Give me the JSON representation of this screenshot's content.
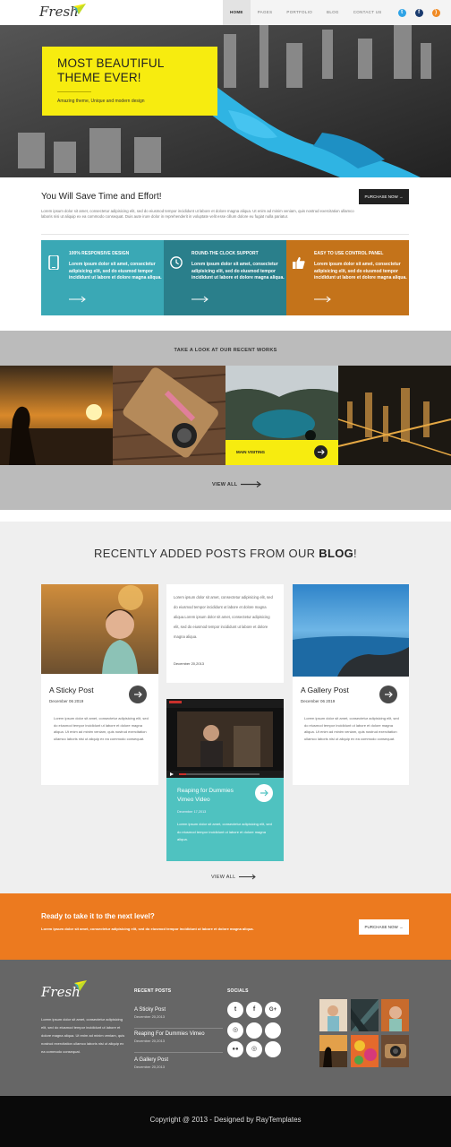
{
  "header": {
    "logo": "Fresh",
    "nav": [
      "HOME",
      "PAGES",
      "PORTFOLIO",
      "BLOG",
      "CONTACT US"
    ],
    "social_icons": [
      "twitter-icon",
      "facebook-icon",
      "rss-icon"
    ]
  },
  "hero": {
    "title": "MOST BEAUTIFUL THEME EVER!",
    "subtitle": "Amazing theme, Unique and modern design"
  },
  "intro": {
    "title": "You Will Save Time and Effort!",
    "text": "Lorem ipsum dolor sit amet, consectetur adipisicing elit, sed do eiusmod tempor incididunt ut labore et dolore magna aliqua. Ut enim ad minim veniam, quis nostrud exercitation ullamco laboris nisi ut aliquip ex ea commodo consequat. Duis aute irure dolor in reprehenderit in voluptate velit esse cillum dolore eu fugiat nulla pariatur.",
    "button": "PURCHASE NOW"
  },
  "features": [
    {
      "title": "100% RESPONSIVE DESIGN",
      "text": "Lorem ipsum dolor sit amet, consectetur adipisicing elit, sed do eiusmod tempor incididunt ut labore et dolore magna aliqua.",
      "color": "#3aa8b5"
    },
    {
      "title": "ROUND-THE CLOCK SUPPORT",
      "text": "Lorem ipsum dolor sit amet, consectetur adipisicing elit, sed do eiusmod tempor incididunt ut labore et dolore magna aliqua.",
      "color": "#2a7f8b"
    },
    {
      "title": "EASY TO USE CONTROL PANEL",
      "text": "Lorem ipsum dolor sit amet, consectetur adipisicing elit, sed do eiusmod tempor incididunt ut labore et dolore magna aliqua.",
      "color": "#c4731a"
    }
  ],
  "works": {
    "title": "TAKE A LOOK AT OUR RECENT WORKS",
    "overlay_label": "MAIN VISITING",
    "view_all": "VIEW ALL"
  },
  "blog": {
    "title_prefix": "RECENTLY ADDED POSTS FROM OUR ",
    "title_bold": "BLOG",
    "title_suffix": "!",
    "posts": [
      {
        "title": "A Sticky Post",
        "date": "December 06 2019",
        "text": "Lorem ipsum dolor sit amet, consectetur adipisicing elit, sed do eiusmod tempor incididunt ut labore et dolore magna aliqua. Ut enim ad minim veniam, quis nostrud exercitation ullamco laboris nisi ut aliquip ex ea commodo consequat."
      },
      {
        "title": "",
        "date": "December 20,2013",
        "text": "Lorem ipsum dolor sit amet, consectetur adipisicing elit, sed do eiusmod tempor incididunt ut labore et dolore magna aliqua.Lorem ipsum dolor sit amet, consectetur adipisicing elit, sed do eiusmod tempor incididunt ut labore et dolore magna aliqua."
      },
      {
        "title": "A Gallery Post",
        "date": "December 06 2019",
        "text": "Lorem ipsum dolor sit amet, consectetur adipisicing elit, sed do eiusmod tempor incididunt ut labore et dolore magna aliqua. Ut enim ad minim veniam, quis nostrud exercitation ullamco laboris nisi ut aliquip ex ea commodo consequat."
      },
      {
        "title": "Reaping for Dummies Vimeo Video",
        "date": "December 17,2013",
        "text": "Lorem ipsum dolor sit amet, consectetur adipisicing elit, sed do eiusmod tempor incididunt ut labore et dolore magna aliqua."
      }
    ],
    "view_all": "VIEW ALL"
  },
  "cta": {
    "title": "Ready to take it to the next level?",
    "text": "Lorem ipsum dolor sit amet, consectetur adipisicing elit, sed do eiusmod tempor incididunt ut labore et dolore magna aliqua.",
    "button": "PURCHASE NOW"
  },
  "footer": {
    "logo": "Fresh",
    "about": "Lorem ipsum dolor sit amet, consectetur adipisicing elit, sed do eiusmod tempor incididunt ut labore et dolore magna aliqua. Ut enim ad minim veniam, quis nostrud exercitation ullamco laboris nisi ut aliquip ex ea commodo consequat.",
    "recent_posts_title": "RECENT POSTS",
    "recent_posts": [
      {
        "title": "A Sticky Post",
        "date": "December 20,2013"
      },
      {
        "title": "Reaping For Dummies Vimeo",
        "date": "December 20,2013"
      },
      {
        "title": "A Gallery Post",
        "date": "December 20,2013"
      }
    ],
    "socials_title": "SOCIALS",
    "social_icons": [
      "twitter-icon",
      "facebook-icon",
      "google-plus-icon",
      "dribbble-icon",
      "blank-icon",
      "blank-icon",
      "flickr-icon",
      "dribbble-icon",
      "blank-icon"
    ],
    "copyright": "Copyright @ 2013 - Designed by RayTemplates"
  }
}
